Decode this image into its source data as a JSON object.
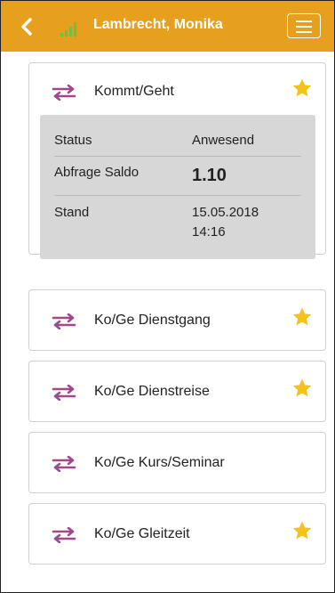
{
  "header": {
    "title": "Lambrecht, Monika",
    "back_icon": "chevron-left-icon",
    "signal_icon": "signal-bars-icon",
    "menu_icon": "hamburger-menu-icon"
  },
  "colors": {
    "header": "#e6a01e",
    "accent_purple": "#a0488a",
    "star": "#f3c21b",
    "signal_green": "#6cc04a",
    "details_bg": "#d7d7d7"
  },
  "main_card": {
    "label": "Kommt/Geht",
    "favorite": true,
    "details": [
      {
        "label": "Status",
        "value": "Anwesend"
      },
      {
        "label": "Abfrage Saldo",
        "value": "1.10"
      },
      {
        "label": "Stand",
        "value": "15.05.2018",
        "value_line2": "14:16"
      }
    ]
  },
  "items": [
    {
      "label": "Ko/Ge Dienstgang",
      "favorite": true
    },
    {
      "label": "Ko/Ge Dienstreise",
      "favorite": true
    },
    {
      "label": "Ko/Ge Kurs/Seminar",
      "favorite": false
    },
    {
      "label": "Ko/Ge Gleitzeit",
      "favorite": true
    }
  ]
}
